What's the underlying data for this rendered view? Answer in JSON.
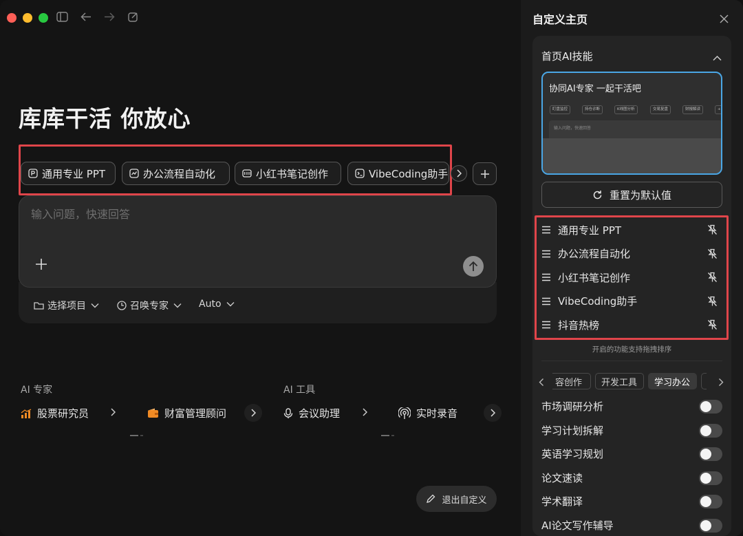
{
  "main": {
    "headline": "库库干活 你放心",
    "chips": [
      {
        "label": "通用专业 PPT",
        "icon": "ppt-icon"
      },
      {
        "label": "办公流程自动化",
        "icon": "chart-icon"
      },
      {
        "label": "小红书笔记创作",
        "icon": "note-icon"
      },
      {
        "label": "VibeCoding助手",
        "icon": "terminal-icon"
      }
    ],
    "input_placeholder": "输入问题，快速回答",
    "options": [
      {
        "label": "选择项目",
        "icon": "project-icon"
      },
      {
        "label": "召唤专家",
        "icon": "expert-icon"
      },
      {
        "label": "Auto",
        "icon": ""
      }
    ],
    "ai_experts": {
      "title": "AI 专家",
      "items": [
        {
          "label": "股票研究员",
          "icon": "stock-chart-icon"
        },
        {
          "label": "财富管理顾问",
          "icon": "wallet-icon"
        }
      ]
    },
    "ai_tools": {
      "title": "AI 工具",
      "items": [
        {
          "label": "会议助理",
          "icon": "microphone-icon"
        },
        {
          "label": "实时录音",
          "icon": "broadcast-icon"
        }
      ]
    },
    "exit_button": "退出自定义"
  },
  "panel": {
    "title": "自定义主页",
    "section_title": "首页AI技能",
    "preview": {
      "title": "协同AI专家  一起干活吧",
      "chips": [
        "盯盘监控",
        "持仓诊断",
        "K线图分析",
        "交易复盘",
        "财报解读"
      ],
      "input_placeholder": "输入问题，快速回答"
    },
    "reset_button": "重置为默认值",
    "skills": [
      "通用专业 PPT",
      "办公流程自动化",
      "小红书笔记创作",
      "VibeCoding助手",
      "抖音热榜"
    ],
    "hint": "开启的功能支持拖拽排序",
    "categories": [
      "容创作",
      "开发工具",
      "学习办公"
    ],
    "active_category": "学习办公",
    "toggles": [
      {
        "label": "市场调研分析",
        "on": false
      },
      {
        "label": "学习计划拆解",
        "on": false
      },
      {
        "label": "英语学习规划",
        "on": false
      },
      {
        "label": "论文速读",
        "on": false
      },
      {
        "label": "学术翻译",
        "on": false
      },
      {
        "label": "AI论文写作辅导",
        "on": false
      }
    ]
  },
  "colors": {
    "highlight_border": "#e0454a",
    "preview_border": "#4aa7e6",
    "traffic_red": "#fe5f57",
    "traffic_yellow": "#febc2e",
    "traffic_green": "#28c840"
  }
}
